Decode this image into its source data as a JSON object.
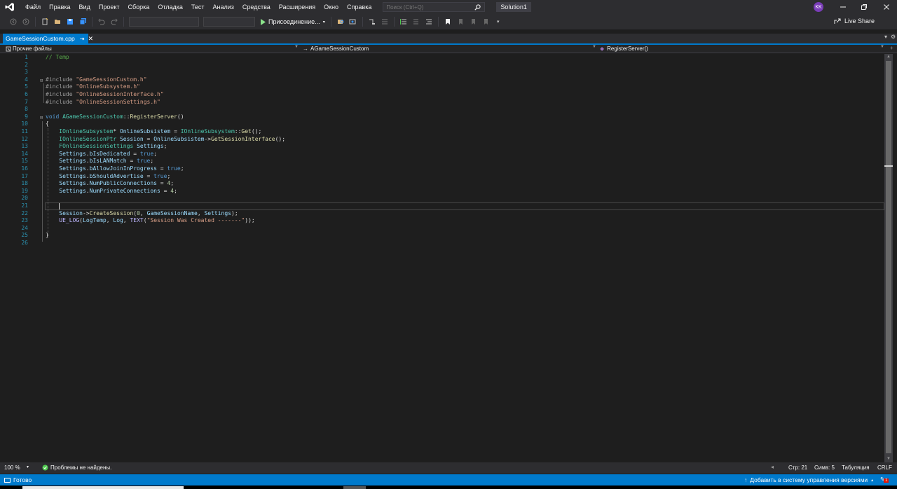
{
  "titlebar": {
    "menu": [
      "Файл",
      "Правка",
      "Вид",
      "Проект",
      "Сборка",
      "Отладка",
      "Тест",
      "Анализ",
      "Средства",
      "Расширения",
      "Окно",
      "Справка"
    ],
    "search_placeholder": "Поиск (Ctrl+Q)",
    "solution": "Solution1",
    "avatar": "KK"
  },
  "toolbar": {
    "attach_label": "Присоединение...",
    "live_share": "Live Share"
  },
  "tab": {
    "filename": "GameSessionCustom.cpp",
    "pin": "⇥",
    "close": "✕"
  },
  "navbar": {
    "project": "Прочие файлы",
    "class": "AGameSessionCustom",
    "method": "RegisterServer()"
  },
  "editor": {
    "lines": [
      "// Temp",
      "",
      "",
      "#include \"GameSessionCustom.h\"",
      "#include \"OnlineSubsystem.h\"",
      "#include \"OnlineSessionInterface.h\"",
      "#include \"OnlineSessionSettings.h\"",
      "",
      "void AGameSessionCustom::RegisterServer()",
      "{",
      "    IOnlineSubsystem* OnlineSubsistem = IOnlineSubsystem::Get();",
      "    IOnlineSessionPtr Session = OnlineSubsistem->GetSessionInterface();",
      "    FOnlineSessionSettings Settings;",
      "    Settings.bIsDedicated = true;",
      "    Settings.bIsLANMatch = true;",
      "    Settings.bAllowJoinInProgress = true;",
      "    Settings.bShouldAdvertise = true;",
      "    Settings.NumPublicConnections = 4;",
      "    Settings.NumPrivateConnections = 4;",
      "",
      "    ",
      "    Session->CreateSession(0, GameSessionName, Settings);",
      "    UE_LOG(LogTemp, Log, TEXT(\"Session Was Created -------\"));",
      "",
      "}",
      ""
    ]
  },
  "infobar": {
    "zoom": "100 %",
    "issues": "Проблемы не найдены.",
    "line": "Стр: 21",
    "col": "Симв: 5",
    "indent": "Табуляция",
    "eol": "CRLF"
  },
  "statusbar": {
    "ready": "Готово",
    "vcs": "Добавить в систему управления версиями",
    "notifications": "1"
  },
  "colors": {
    "accent": "#007acc",
    "editor_bg": "#1e1e1e",
    "chrome_bg": "#2d2d30",
    "ok_green": "#4ec94e"
  }
}
